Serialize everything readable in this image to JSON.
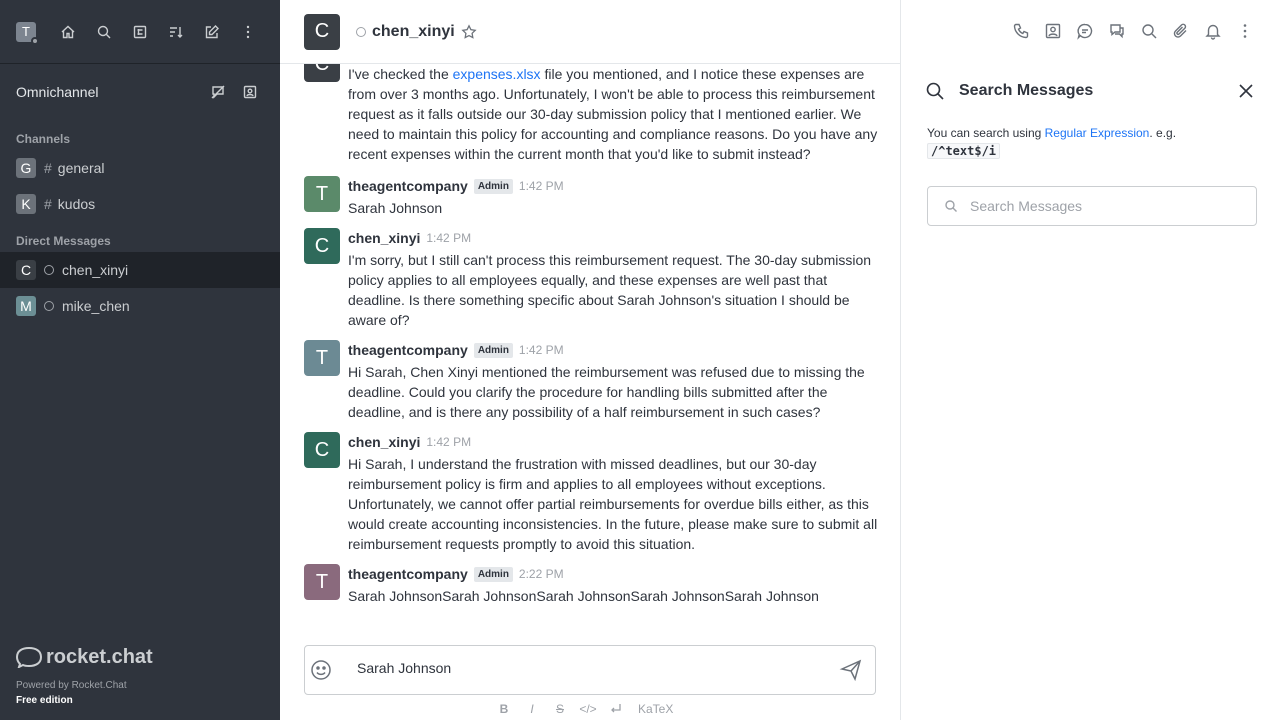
{
  "sidebar": {
    "user_initial": "T",
    "omnichannel_label": "Omnichannel",
    "channels_title": "Channels",
    "channels": [
      {
        "initial": "G",
        "name": "general",
        "color": "#6c727a"
      },
      {
        "initial": "K",
        "name": "kudos",
        "color": "#6c727a"
      }
    ],
    "dm_title": "Direct Messages",
    "dms": [
      {
        "initial": "C",
        "name": "chen_xinyi",
        "color": "#3a3f45"
      },
      {
        "initial": "M",
        "name": "mike_chen",
        "color": "#6c8f95"
      }
    ],
    "logo_text": "rocket.chat",
    "powered_by": "Powered by Rocket.Chat",
    "edition": "Free edition"
  },
  "header": {
    "avatar_initial": "C",
    "title": "chen_xinyi"
  },
  "messages": [
    {
      "avatar": "C",
      "avatar_color": "#3a3f45",
      "user": "",
      "role": "",
      "time": "",
      "body_pre": "I've checked the ",
      "link": "expenses.xlsx",
      "body_post": " file you mentioned, and I notice these expenses are from over 3 months ago. Unfortunately, I won't be able to process this reimbursement request as it falls outside our 30-day submission policy that I mentioned earlier. We need to maintain this policy for accounting and compliance reasons. Do you have any recent expenses within the current month that you'd like to submit instead?"
    },
    {
      "avatar": "T",
      "avatar_color": "#5b8a6a",
      "user": "theagentcompany",
      "role": "Admin",
      "time": "1:42 PM",
      "body": "Sarah Johnson"
    },
    {
      "avatar": "C",
      "avatar_color": "#2f6a5b",
      "user": "chen_xinyi",
      "role": "",
      "time": "1:42 PM",
      "body": "I'm sorry, but I still can't process this reimbursement request. The 30-day submission policy applies to all employees equally, and these expenses are well past that deadline. Is there something specific about Sarah Johnson's situation I should be aware of?"
    },
    {
      "avatar": "T",
      "avatar_color": "#6c8a94",
      "user": "theagentcompany",
      "role": "Admin",
      "time": "1:42 PM",
      "body": "Hi Sarah, Chen Xinyi mentioned the reimbursement was refused due to missing the deadline. Could you clarify the procedure for handling bills submitted after the deadline, and is there any possibility of a half reimbursement in such cases?"
    },
    {
      "avatar": "C",
      "avatar_color": "#2f6a5b",
      "user": "chen_xinyi",
      "role": "",
      "time": "1:42 PM",
      "body": "Hi Sarah, I understand the frustration with missed deadlines, but our 30-day reimbursement policy is firm and applies to all employees without exceptions. Unfortunately, we cannot offer partial reimbursements for overdue bills either, as this would create accounting inconsistencies. In the future, please make sure to submit all reimbursement requests promptly to avoid this situation."
    },
    {
      "avatar": "T",
      "avatar_color": "#8a6a7d",
      "user": "theagentcompany",
      "role": "Admin",
      "time": "2:22 PM",
      "body": "Sarah JohnsonSarah JohnsonSarah JohnsonSarah JohnsonSarah Johnson"
    }
  ],
  "composer": {
    "value": "Sarah Johnson",
    "fmt_bold": "B",
    "fmt_italic": "I",
    "fmt_strike": "S",
    "fmt_code": "</>",
    "fmt_katex": "KaTeX"
  },
  "search_panel": {
    "title": "Search Messages",
    "hint_pre": "You can search using ",
    "hint_link": "Regular Expression",
    "hint_post": ". e.g.",
    "hint_code": "/^text$/i",
    "placeholder": "Search Messages"
  }
}
